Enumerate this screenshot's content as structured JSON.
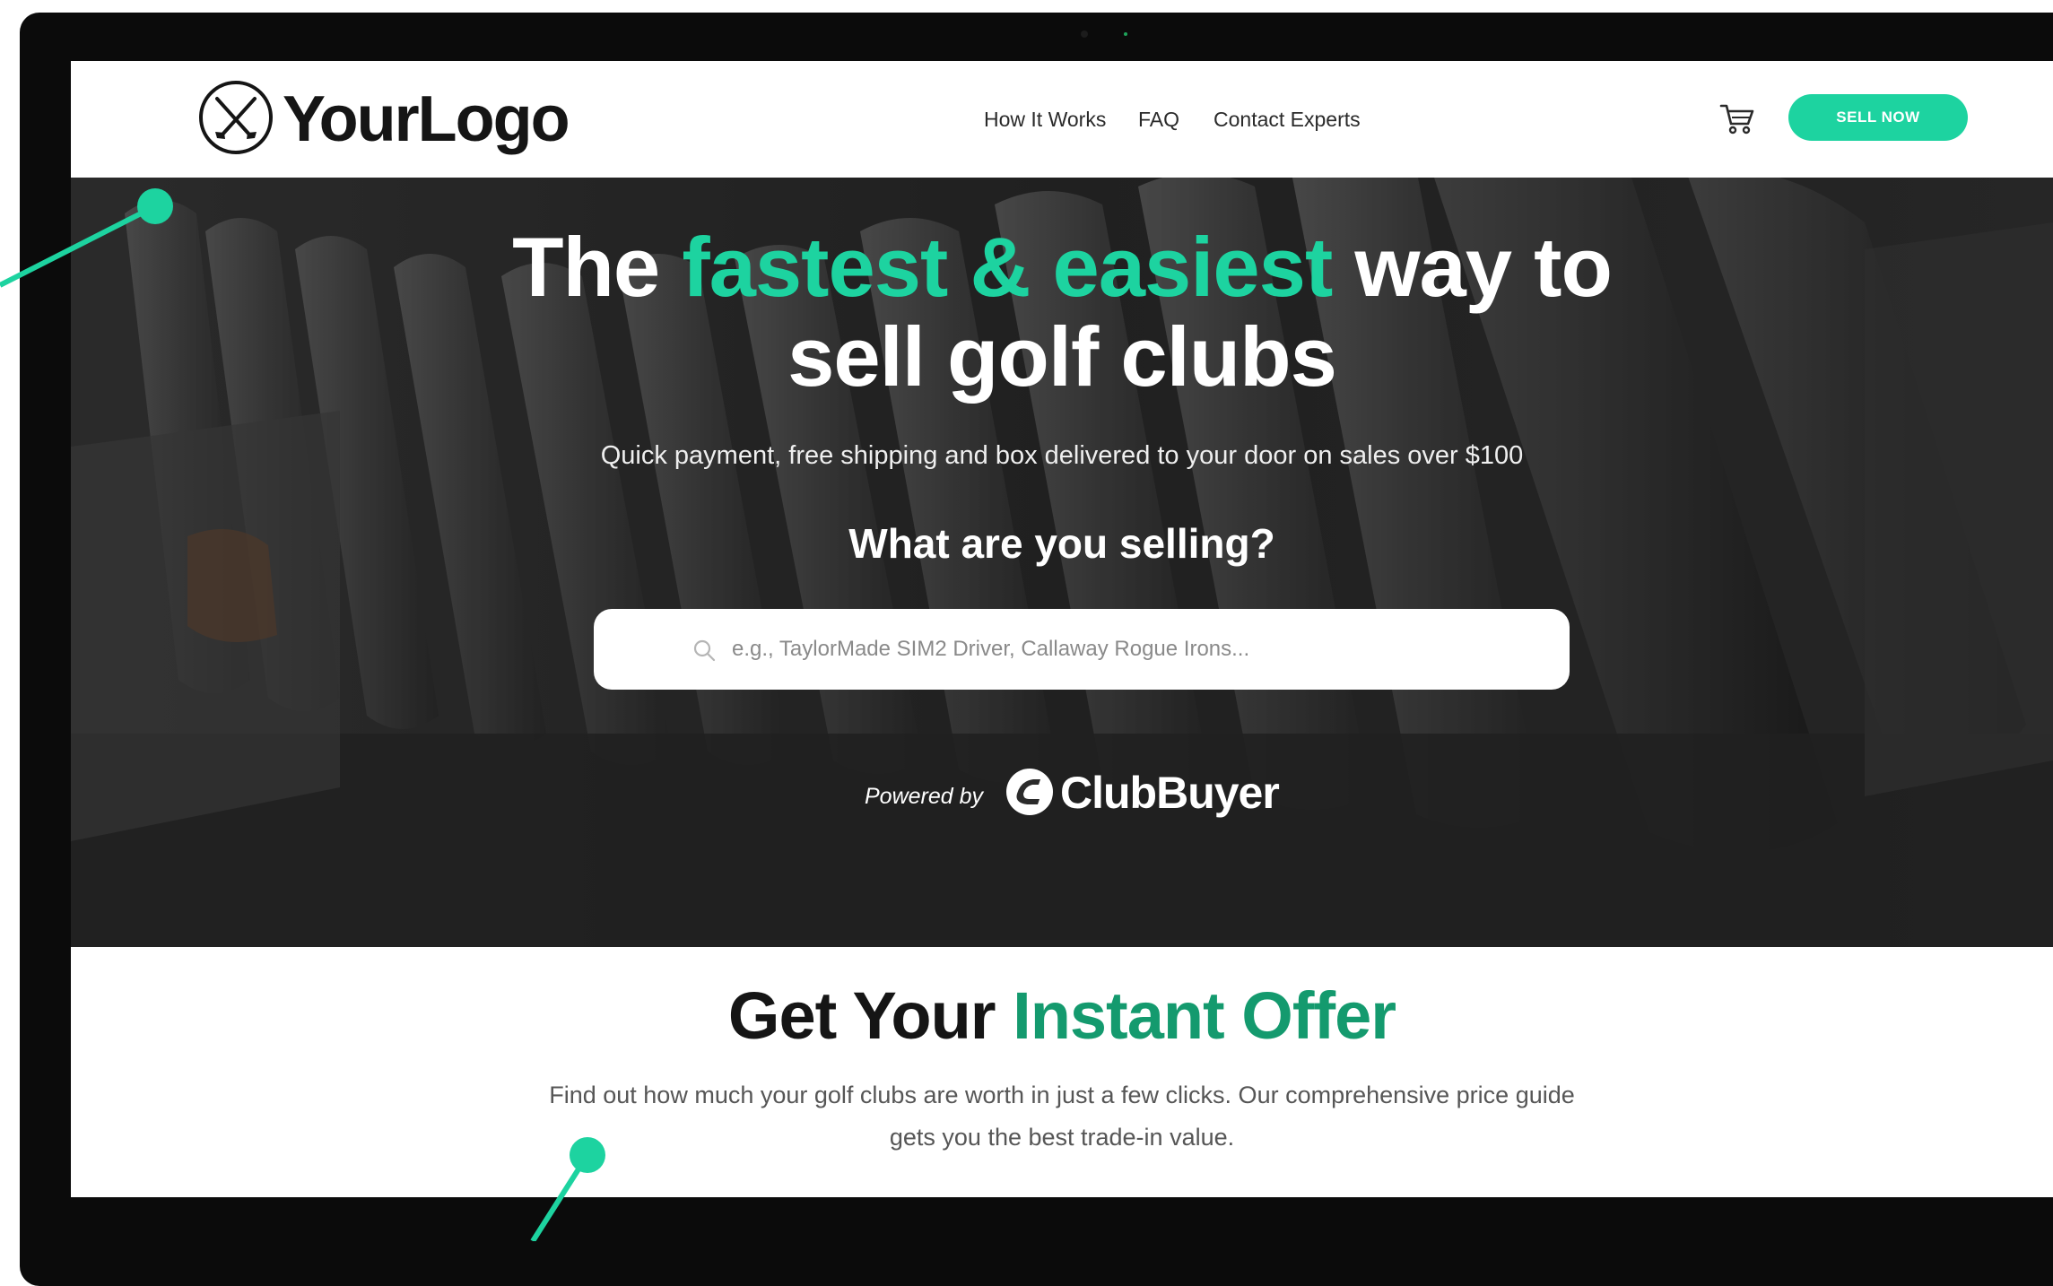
{
  "brand": {
    "logo_text": "YourLogo",
    "accent_color": "#1dd3a0",
    "accent_dark": "#149a6e"
  },
  "nav": {
    "links": [
      "How It Works",
      "FAQ",
      "Contact Experts"
    ],
    "cart_icon": "cart-icon",
    "cta_label": "SELL NOW"
  },
  "hero": {
    "title_pre": "The ",
    "title_accent": "fastest & easiest",
    "title_post": " way to",
    "title_line2": "sell golf clubs",
    "subtitle": "Quick payment, free shipping and box delivered to your door on sales over $100",
    "question": "What are you selling?",
    "search_placeholder": "e.g., TaylorMade SIM2 Driver, Callaway Rogue Irons...",
    "search_icon": "search-icon",
    "powered_by": "Powered by",
    "partner_name": "ClubBuyer"
  },
  "offer": {
    "title_pre": "Get Your ",
    "title_accent": "Instant Offer",
    "desc_line1": "Find out how much your golf clubs are worth in just a few clicks. Our comprehensive price guide",
    "desc_line2": "gets you the best trade-in value."
  }
}
